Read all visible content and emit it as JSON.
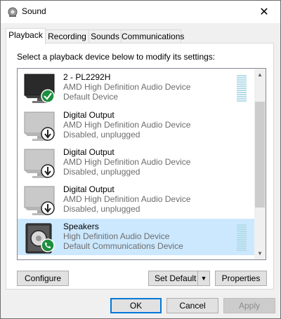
{
  "window": {
    "title": "Sound",
    "close_glyph": "✕"
  },
  "tabs": [
    {
      "label": "Playback",
      "active": true
    },
    {
      "label": "Recording",
      "active": false
    },
    {
      "label": "Sounds",
      "active": false
    },
    {
      "label": "Communications",
      "active": false
    }
  ],
  "playback": {
    "instruction": "Select a playback device below to modify its settings:",
    "devices": [
      {
        "name": "2 - PL2292H",
        "driver": "AMD High Definition Audio Device",
        "status": "Default Device",
        "icon": "monitor-icon",
        "badge": "default-check-icon",
        "selected": false
      },
      {
        "name": "Digital Output",
        "driver": "AMD High Definition Audio Device",
        "status": "Disabled, unplugged",
        "icon": "monitor-icon",
        "badge": "down-arrow-icon",
        "selected": false
      },
      {
        "name": "Digital Output",
        "driver": "AMD High Definition Audio Device",
        "status": "Disabled, unplugged",
        "icon": "monitor-icon",
        "badge": "down-arrow-icon",
        "selected": false
      },
      {
        "name": "Digital Output",
        "driver": "AMD High Definition Audio Device",
        "status": "Disabled, unplugged",
        "icon": "monitor-icon",
        "badge": "down-arrow-icon",
        "selected": false
      },
      {
        "name": "Speakers",
        "driver": "High Definition Audio Device",
        "status": "Default Communications Device",
        "icon": "speaker-icon",
        "badge": "phone-icon",
        "selected": true
      }
    ]
  },
  "buttons": {
    "configure": "Configure",
    "set_default": "Set Default",
    "properties": "Properties",
    "ok": "OK",
    "cancel": "Cancel",
    "apply": "Apply"
  },
  "colors": {
    "selection": "#cce8ff",
    "meter": "#b4dce8",
    "check_badge": "#1e8e3e",
    "accent": "#0078d7"
  }
}
